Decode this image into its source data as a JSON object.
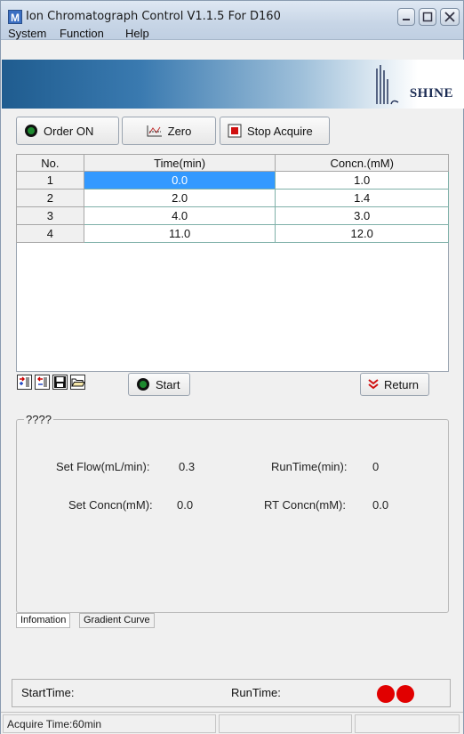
{
  "window": {
    "app_icon_letter": "M",
    "title": "Ion Chromatograph Control V1.1.5 For D160",
    "logo_text": "SHINE"
  },
  "menu": {
    "items": [
      "System",
      "Function",
      "Help"
    ]
  },
  "toolbar": {
    "order_on_label": "Order ON",
    "zero_label": "Zero",
    "stop_acquire_label": "Stop Acquire"
  },
  "table": {
    "headers": [
      "No.",
      "Time(min)",
      "Concn.(mM)"
    ],
    "rows": [
      {
        "no": "1",
        "time": "0.0",
        "concn": "1.0"
      },
      {
        "no": "2",
        "time": "2.0",
        "concn": "1.4"
      },
      {
        "no": "3",
        "time": "4.0",
        "concn": "3.0"
      },
      {
        "no": "4",
        "time": "11.0",
        "concn": "12.0"
      }
    ],
    "selected_row": 0,
    "selected_column": "time"
  },
  "table_controls": {
    "start_label": "Start",
    "return_label": "Return"
  },
  "info_panel": {
    "legend": "????",
    "set_flow_label": "Set Flow(mL/min):",
    "set_flow_value": "0.3",
    "runtime_label": "RunTime(min):",
    "runtime_value": "0",
    "set_concn_label": "Set Concn(mM):",
    "set_concn_value": "0.0",
    "rt_concn_label": "RT Concn(mM):",
    "rt_concn_value": "0.0"
  },
  "tabs": [
    {
      "label": "Infomation",
      "active": true
    },
    {
      "label": "Gradient Curve",
      "active": false
    }
  ],
  "status": {
    "start_time_label": "StartTime:",
    "run_time_label": "RunTime:",
    "led_color": "#e10000"
  },
  "statusbar": {
    "acquire_time": "Acquire Time:60min"
  },
  "colors": {
    "selection": "#3399ff",
    "banner_dark": "#1f5c8f",
    "indicator_green": "#1d8a2f"
  }
}
